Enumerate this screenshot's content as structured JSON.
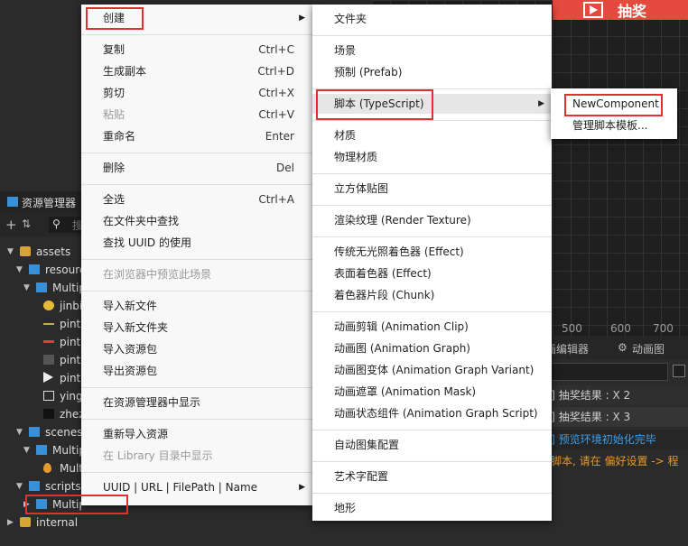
{
  "play_label": "抽奖",
  "scene_axis": [
    "500",
    "600",
    "700"
  ],
  "panel_tabs": [
    "画编辑器",
    "动画图"
  ],
  "console_logs": [
    {
      "text": "or] 抽奖结果 : X 2",
      "kind": "a"
    },
    {
      "text": "or] 抽奖结果 : X 3",
      "kind": "b"
    },
    {
      "text": "or] 预览环境初始化完毕",
      "kind": "c"
    },
    {
      "text": "开脚本, 请在 偏好设置 -> 程",
      "kind": "d"
    }
  ],
  "asset_panel": {
    "title": "资源管理器",
    "search_placeholder": "搜",
    "tree": [
      {
        "label": "assets",
        "icon": "database-icon"
      },
      {
        "label": "resources",
        "icon": "folder-icon"
      },
      {
        "label": "MultipleLottery",
        "icon": "folder-icon"
      },
      {
        "label": "jinbi",
        "icon": "coin-icon"
      },
      {
        "label": "pintu",
        "icon": "line-icon"
      },
      {
        "label": "pintu",
        "icon": "red-line-icon"
      },
      {
        "label": "pintu",
        "icon": "dark-image-icon"
      },
      {
        "label": "pintu",
        "icon": "play-icon"
      },
      {
        "label": "yingyi",
        "icon": "video-icon"
      },
      {
        "label": "zhezhao",
        "icon": "black-image-icon"
      },
      {
        "label": "scenes",
        "icon": "folder-icon"
      },
      {
        "label": "MultipleLottery",
        "icon": "folder-icon"
      },
      {
        "label": "MultipleLottery",
        "icon": "scene-icon"
      },
      {
        "label": "scripts",
        "icon": "folder-icon"
      },
      {
        "label": "MultipleLottery",
        "icon": "folder-icon"
      },
      {
        "label": "internal",
        "icon": "database-icon"
      }
    ]
  },
  "menu_main": [
    {
      "label": "创建",
      "submenu": true
    },
    {
      "sep": true
    },
    {
      "label": "复制",
      "shortcut": "Ctrl+C"
    },
    {
      "label": "生成副本",
      "shortcut": "Ctrl+D"
    },
    {
      "label": "剪切",
      "shortcut": "Ctrl+X"
    },
    {
      "label": "粘贴",
      "shortcut": "Ctrl+V",
      "disabled": true
    },
    {
      "label": "重命名",
      "shortcut": "Enter"
    },
    {
      "sep": true
    },
    {
      "label": "删除",
      "shortcut": "Del"
    },
    {
      "sep": true
    },
    {
      "label": "全选",
      "shortcut": "Ctrl+A"
    },
    {
      "label": "在文件夹中查找"
    },
    {
      "label": "查找 UUID 的使用"
    },
    {
      "sep": true
    },
    {
      "label": "在浏览器中预览此场景",
      "disabled": true
    },
    {
      "sep": true
    },
    {
      "label": "导入新文件"
    },
    {
      "label": "导入新文件夹"
    },
    {
      "label": "导入资源包"
    },
    {
      "label": "导出资源包"
    },
    {
      "sep": true
    },
    {
      "label": "在资源管理器中显示"
    },
    {
      "sep": true
    },
    {
      "label": "重新导入资源"
    },
    {
      "label": "在 Library 目录中显示",
      "disabled": true
    },
    {
      "sep": true
    },
    {
      "label": "UUID | URL | FilePath | Name",
      "submenu": true
    }
  ],
  "menu_create": [
    {
      "label": "文件夹"
    },
    {
      "sep": true
    },
    {
      "label": "场景"
    },
    {
      "label": "预制 (Prefab)"
    },
    {
      "sep": true
    },
    {
      "label": "脚本 (TypeScript)",
      "submenu": true,
      "highlight": true
    },
    {
      "sep": true
    },
    {
      "label": "材质"
    },
    {
      "label": "物理材质"
    },
    {
      "sep": true
    },
    {
      "label": "立方体贴图"
    },
    {
      "sep": true
    },
    {
      "label": "渲染纹理 (Render Texture)"
    },
    {
      "sep": true
    },
    {
      "label": "传统无光照着色器 (Effect)"
    },
    {
      "label": "表面着色器 (Effect)"
    },
    {
      "label": "着色器片段 (Chunk)"
    },
    {
      "sep": true
    },
    {
      "label": "动画剪辑 (Animation Clip)"
    },
    {
      "label": "动画图 (Animation Graph)"
    },
    {
      "label": "动画图变体 (Animation Graph Variant)"
    },
    {
      "label": "动画遮罩 (Animation Mask)"
    },
    {
      "label": "动画状态组件 (Animation Graph Script)"
    },
    {
      "sep": true
    },
    {
      "label": "自动图集配置"
    },
    {
      "sep": true
    },
    {
      "label": "艺术字配置"
    },
    {
      "sep": true
    },
    {
      "label": "地形"
    }
  ],
  "menu_script": [
    {
      "label": "NewComponent"
    },
    {
      "label": "管理脚本模板..."
    }
  ]
}
